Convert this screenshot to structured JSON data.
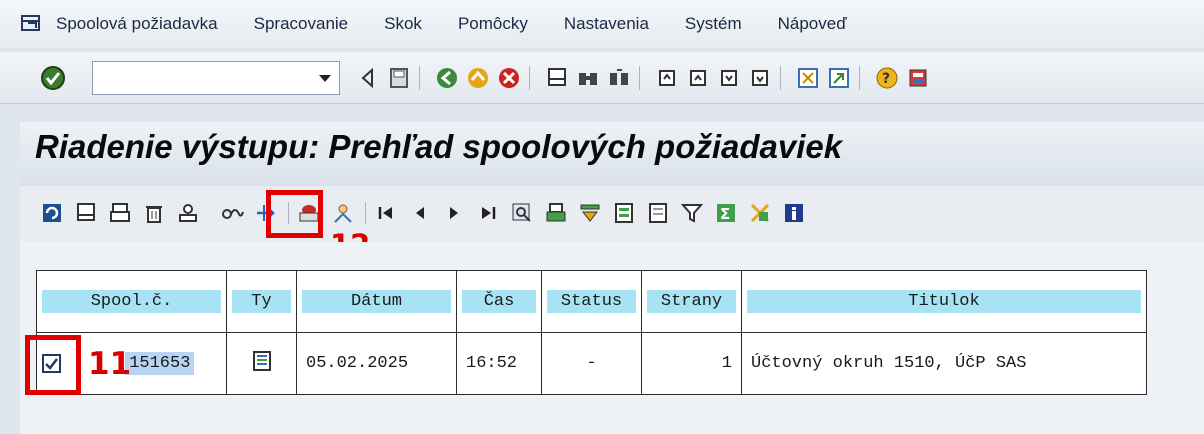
{
  "menu": {
    "items": [
      {
        "label": "Spoolová požiadavka"
      },
      {
        "label": "Spracovanie"
      },
      {
        "label": "Skok"
      },
      {
        "label": "Pomôcky"
      },
      {
        "label": "Nastavenia"
      },
      {
        "label": "Systém"
      },
      {
        "label": "Nápoveď"
      }
    ]
  },
  "toolbar": {
    "command_field_value": ""
  },
  "page": {
    "title": "Riadenie výstupu: Prehľad spoolových požiadaviek"
  },
  "annotations": {
    "mark_11": "11",
    "mark_12": "12"
  },
  "table": {
    "headers": [
      "Spool.č.",
      "Ty",
      "Dátum",
      "Čas",
      "Status",
      "Strany",
      "Titulok"
    ],
    "rows": [
      {
        "spool": "151653",
        "date": "05.02.2025",
        "time": "16:52",
        "status": "-",
        "pages": "1",
        "title": "Účtovný okruh 1510, ÚčP SAS"
      }
    ]
  },
  "colors": {
    "annotation": "#e00000",
    "header_fill": "#a7e3f4"
  }
}
